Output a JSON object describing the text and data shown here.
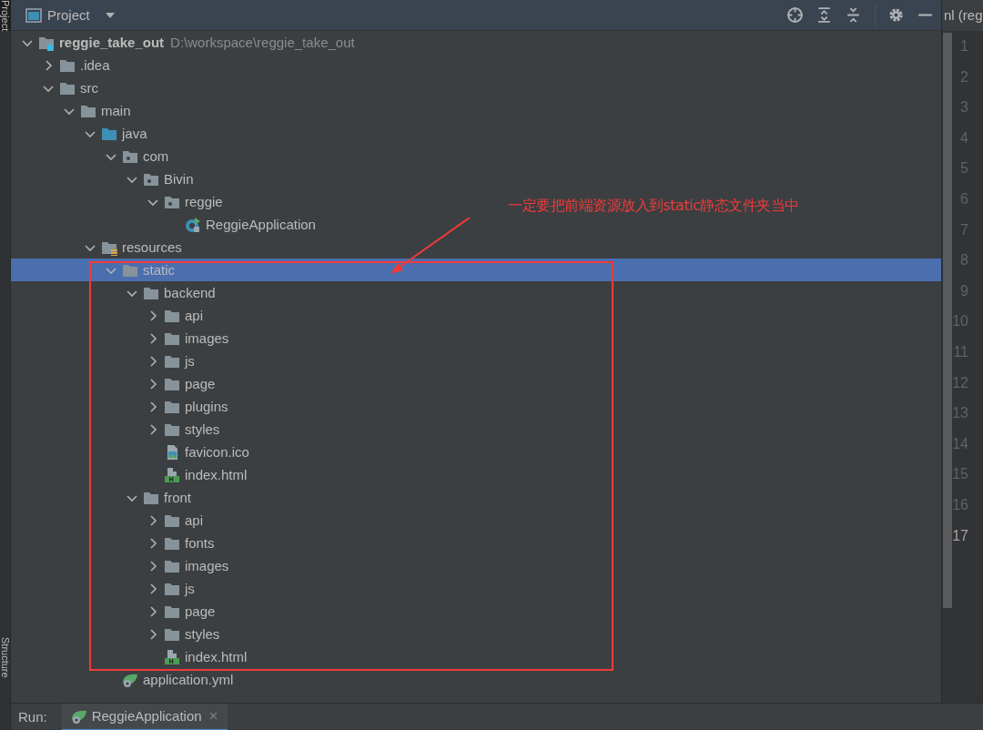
{
  "side_strip": {
    "top_label": "Project",
    "bottom_label": "Structure"
  },
  "panel": {
    "title": "Project"
  },
  "tree": [
    {
      "name": "reggie_take_out",
      "location": "D:\\workspace\\reggie_take_out",
      "kind": "module",
      "expanded": true,
      "selected": false,
      "children": [
        {
          "name": ".idea",
          "kind": "folder",
          "expanded": false,
          "selected": false
        },
        {
          "name": "src",
          "kind": "folder",
          "expanded": true,
          "selected": false,
          "children": [
            {
              "name": "main",
              "kind": "folder",
              "expanded": true,
              "selected": false,
              "children": [
                {
                  "name": "java",
                  "kind": "source",
                  "expanded": true,
                  "selected": false,
                  "children": [
                    {
                      "name": "com",
                      "kind": "package",
                      "expanded": true,
                      "selected": false,
                      "children": [
                        {
                          "name": "Bivin",
                          "kind": "package",
                          "expanded": true,
                          "selected": false,
                          "children": [
                            {
                              "name": "reggie",
                              "kind": "package",
                              "expanded": true,
                              "selected": false,
                              "children": [
                                {
                                  "name": "ReggieApplication",
                                  "kind": "class",
                                  "selected": false
                                }
                              ]
                            }
                          ]
                        }
                      ]
                    }
                  ]
                },
                {
                  "name": "resources",
                  "kind": "resources",
                  "expanded": true,
                  "selected": false,
                  "children": [
                    {
                      "name": "static",
                      "kind": "folder",
                      "expanded": true,
                      "selected": true,
                      "children": [
                        {
                          "name": "backend",
                          "kind": "folder",
                          "expanded": true,
                          "selected": false,
                          "children": [
                            {
                              "name": "api",
                              "kind": "folder",
                              "expanded": false,
                              "selected": false
                            },
                            {
                              "name": "images",
                              "kind": "folder",
                              "expanded": false,
                              "selected": false
                            },
                            {
                              "name": "js",
                              "kind": "folder",
                              "expanded": false,
                              "selected": false
                            },
                            {
                              "name": "page",
                              "kind": "folder",
                              "expanded": false,
                              "selected": false
                            },
                            {
                              "name": "plugins",
                              "kind": "folder",
                              "expanded": false,
                              "selected": false
                            },
                            {
                              "name": "styles",
                              "kind": "folder",
                              "expanded": false,
                              "selected": false
                            },
                            {
                              "name": "favicon.ico",
                              "kind": "image",
                              "selected": false
                            },
                            {
                              "name": "index.html",
                              "kind": "html",
                              "selected": false
                            }
                          ]
                        },
                        {
                          "name": "front",
                          "kind": "folder",
                          "expanded": true,
                          "selected": false,
                          "children": [
                            {
                              "name": "api",
                              "kind": "folder",
                              "expanded": false,
                              "selected": false
                            },
                            {
                              "name": "fonts",
                              "kind": "folder",
                              "expanded": false,
                              "selected": false
                            },
                            {
                              "name": "images",
                              "kind": "folder",
                              "expanded": false,
                              "selected": false
                            },
                            {
                              "name": "js",
                              "kind": "folder",
                              "expanded": false,
                              "selected": false
                            },
                            {
                              "name": "page",
                              "kind": "folder",
                              "expanded": false,
                              "selected": false
                            },
                            {
                              "name": "styles",
                              "kind": "folder",
                              "expanded": false,
                              "selected": false
                            },
                            {
                              "name": "index.html",
                              "kind": "html",
                              "selected": false
                            }
                          ]
                        }
                      ]
                    },
                    {
                      "name": "application.yml",
                      "kind": "yaml",
                      "selected": false
                    }
                  ]
                }
              ]
            }
          ]
        }
      ]
    }
  ],
  "annotation": {
    "text": "一定要把前端资源放入到static静态文件夹当中"
  },
  "editor": {
    "tab_title": "nl (reg",
    "lines": [
      {
        "number": "1",
        "current": false
      },
      {
        "number": "2",
        "current": false
      },
      {
        "number": "3",
        "current": false
      },
      {
        "number": "4",
        "current": false
      },
      {
        "number": "5",
        "current": false
      },
      {
        "number": "6",
        "current": false
      },
      {
        "number": "7",
        "current": false
      },
      {
        "number": "8",
        "current": false
      },
      {
        "number": "9",
        "current": false
      },
      {
        "number": "10",
        "current": false
      },
      {
        "number": "11",
        "current": false
      },
      {
        "number": "12",
        "current": false
      },
      {
        "number": "13",
        "current": false
      },
      {
        "number": "14",
        "current": false
      },
      {
        "number": "15",
        "current": false
      },
      {
        "number": "16",
        "current": false
      },
      {
        "number": "17",
        "current": true
      }
    ]
  },
  "run_bar": {
    "label": "Run:",
    "tab": "ReggieApplication",
    "close": "×"
  }
}
